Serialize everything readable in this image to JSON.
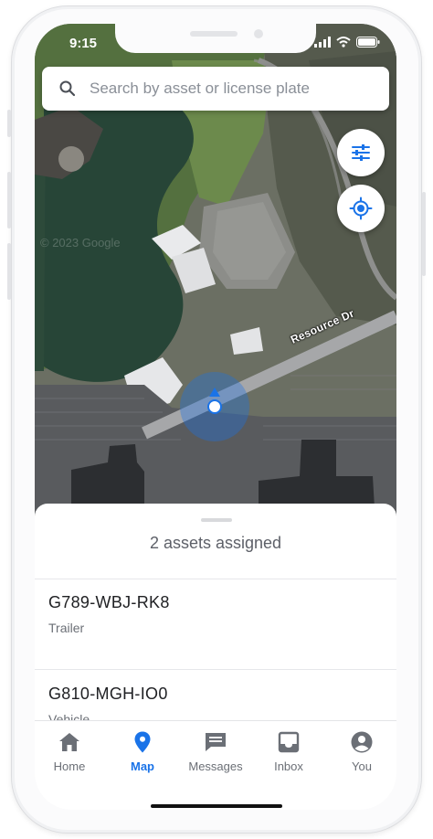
{
  "status_bar": {
    "time": "9:15"
  },
  "search": {
    "placeholder": "Search by asset or license plate",
    "icon": "search-icon"
  },
  "map": {
    "street_label": "Resource Dr",
    "watermark": "© 2023 Google",
    "filter_button_icon": "tune-icon",
    "locate_button_icon": "my-location-icon",
    "accent_color": "#1a73e8"
  },
  "sheet": {
    "count_label": "2 assets assigned",
    "assets": [
      {
        "plate": "G789-WBJ-RK8",
        "type": "Trailer"
      },
      {
        "plate": "G810-MGH-IO0",
        "type": "Vehicle"
      }
    ]
  },
  "tabs": [
    {
      "label": "Home",
      "icon": "home-icon",
      "active": false
    },
    {
      "label": "Map",
      "icon": "map-pin-icon",
      "active": true
    },
    {
      "label": "Messages",
      "icon": "message-icon",
      "active": false
    },
    {
      "label": "Inbox",
      "icon": "inbox-icon",
      "active": false
    },
    {
      "label": "You",
      "icon": "account-icon",
      "active": false
    }
  ]
}
